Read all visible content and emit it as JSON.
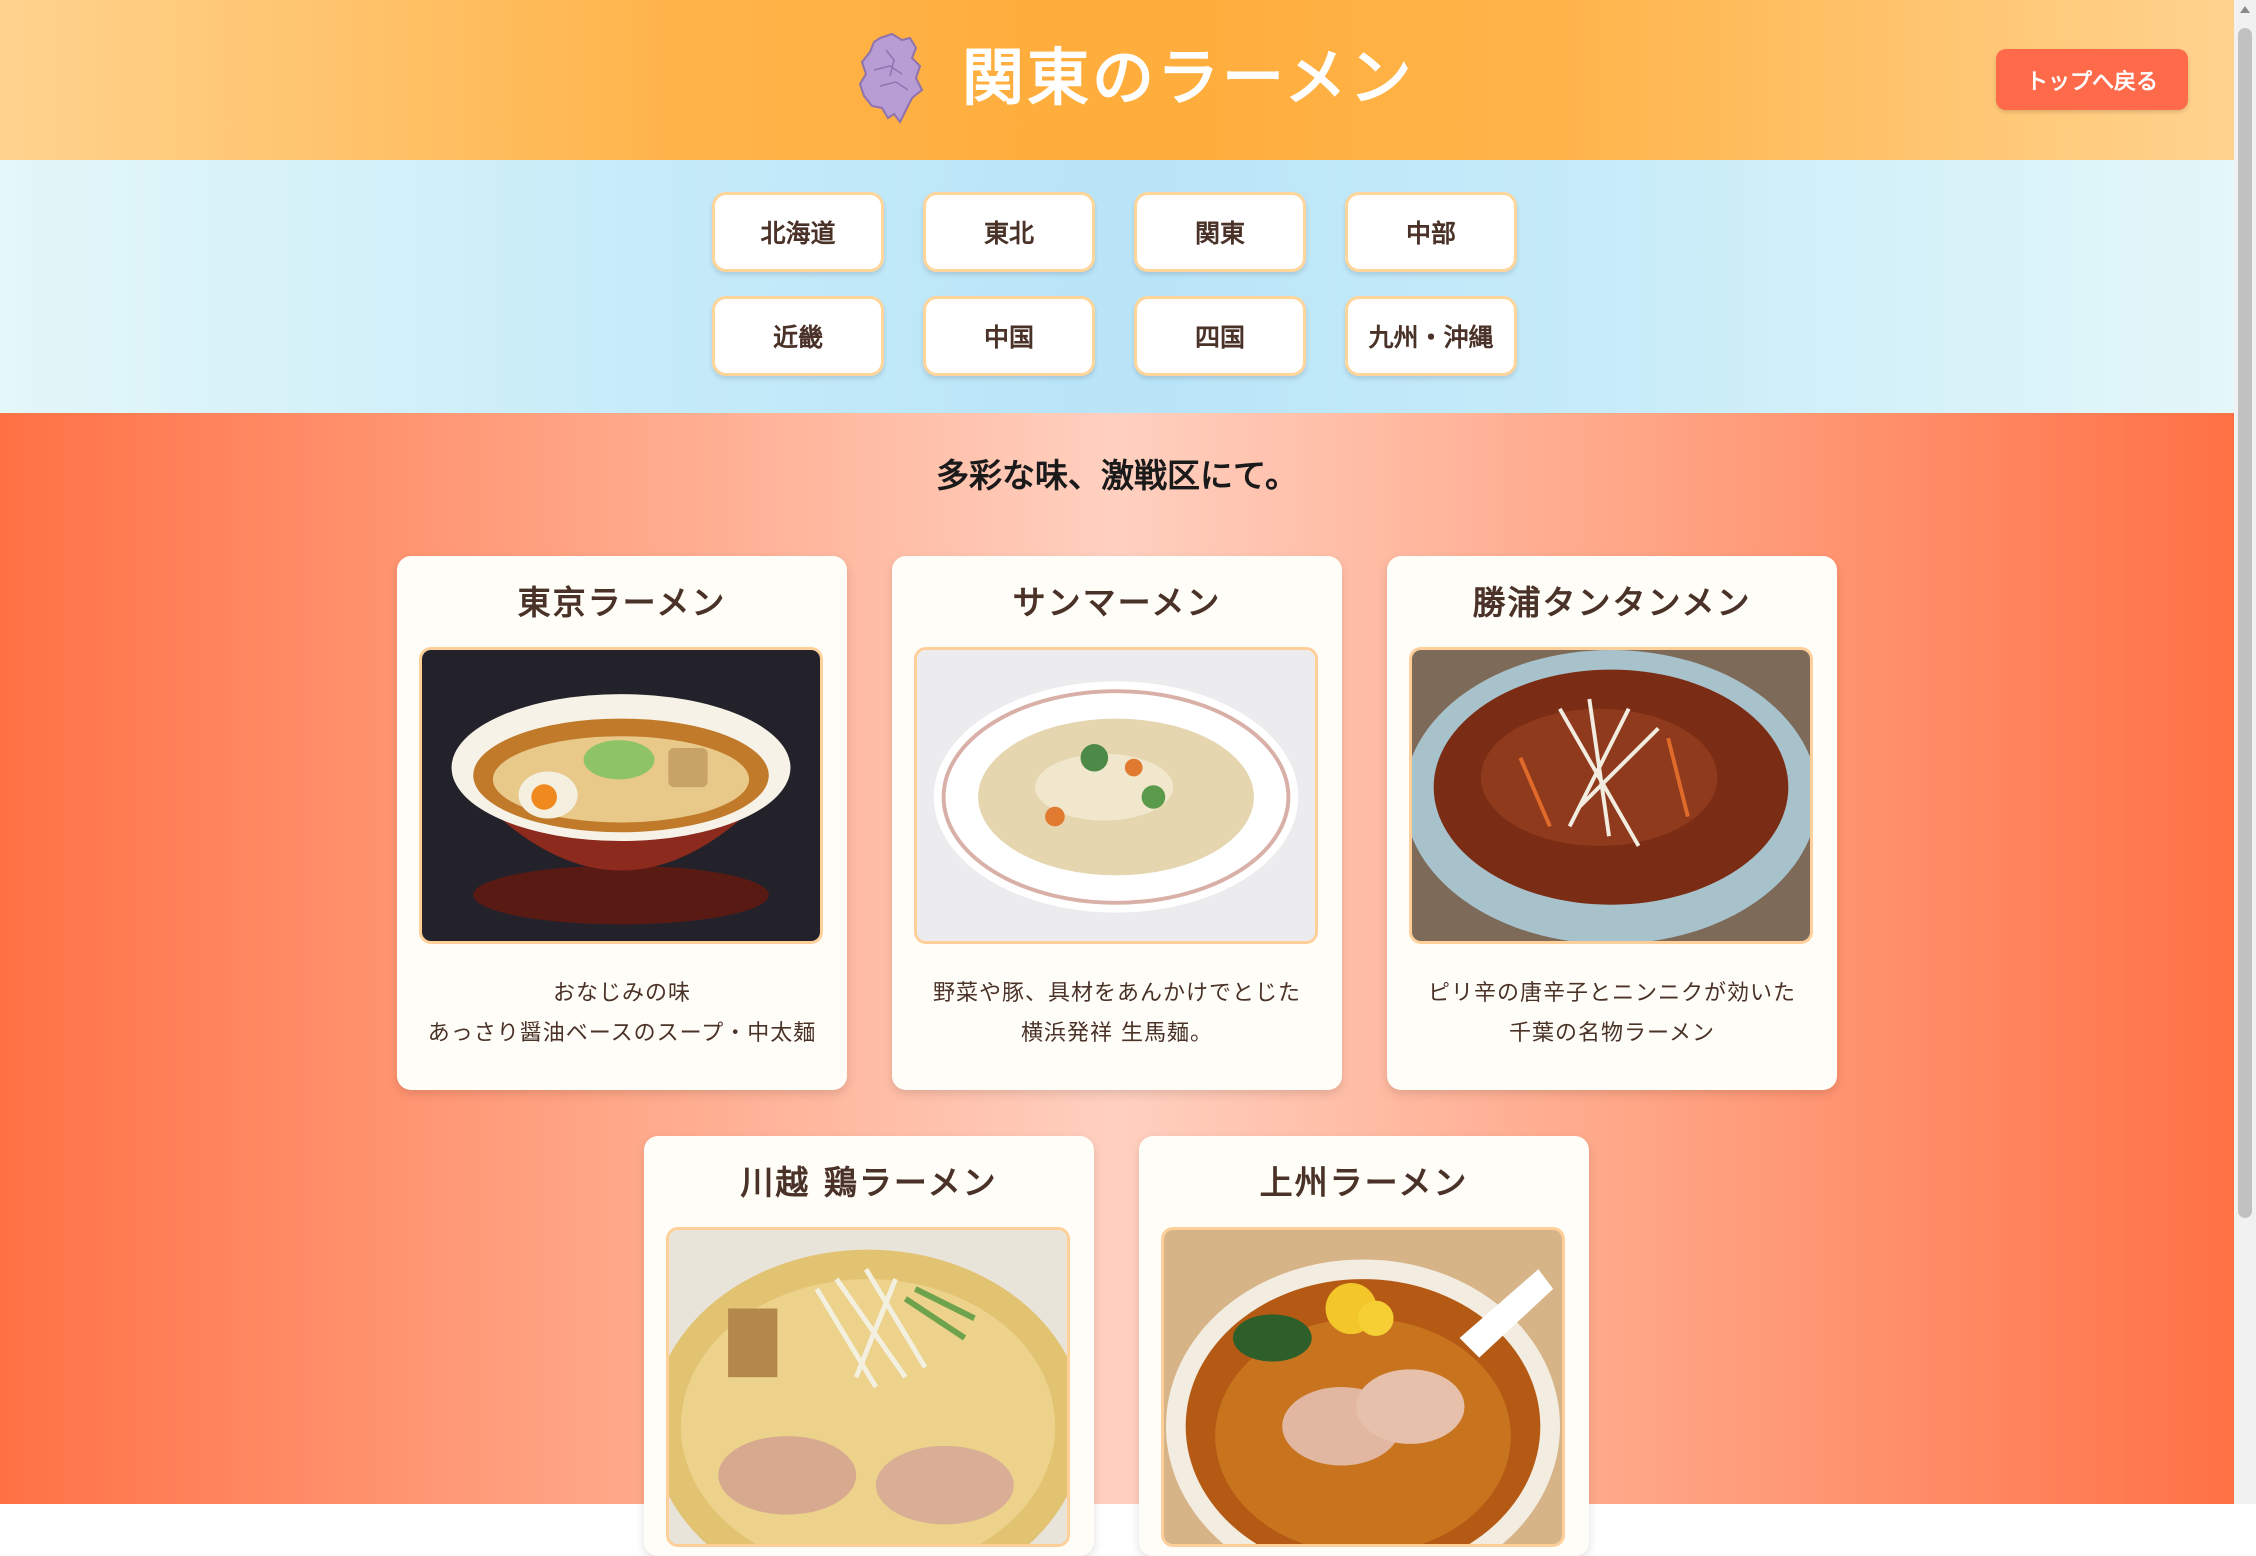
{
  "header": {
    "title": "関東のラーメン",
    "back_label": "トップへ戻る",
    "logo_icon": "kanto-map-icon"
  },
  "regions": [
    "北海道",
    "東北",
    "関東",
    "中部",
    "近畿",
    "中国",
    "四国",
    "九州・沖縄"
  ],
  "tagline": "多彩な味、激戦区にて。",
  "cards": [
    {
      "title": "東京ラーメン",
      "line1": "おなじみの味",
      "line2": "あっさり醤油ベースのスープ・中太麺",
      "image": "tokyo-ramen-image"
    },
    {
      "title": "サンマーメン",
      "line1": "野菜や豚、具材をあんかけでとじた",
      "line2": "横浜発祥 生馬麺。",
      "image": "sanmamen-image"
    },
    {
      "title": "勝浦タンタンメン",
      "line1": "ピリ辛の唐辛子とニンニクが効いた",
      "line2": "千葉の名物ラーメン",
      "image": "katsuura-tantanmen-image"
    },
    {
      "title": "川越 鶏ラーメン",
      "line1": "",
      "line2": "",
      "image": "kawagoe-tori-ramen-image"
    },
    {
      "title": "上州ラーメン",
      "line1": "",
      "line2": "",
      "image": "joshu-ramen-image"
    }
  ],
  "colors": {
    "header_accent": "#ffad3b",
    "back_button": "#ff6b4a",
    "nav_background": "#c5ebf9",
    "main_accent": "#ff7145"
  }
}
